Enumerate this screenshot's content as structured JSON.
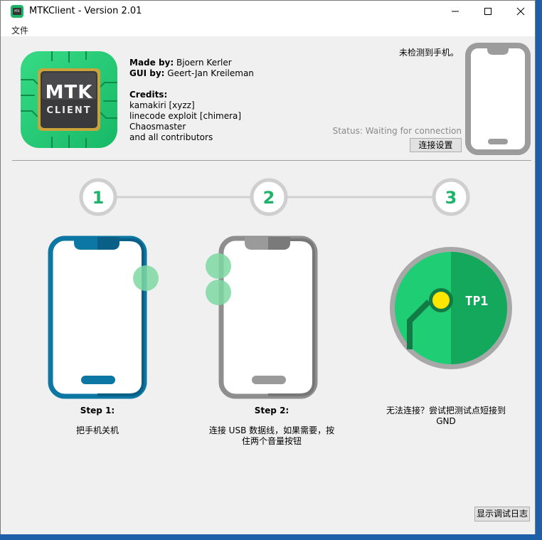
{
  "window": {
    "title": "MTKClient - Version 2.01",
    "icon_text": "MTK"
  },
  "menu": {
    "file": "文件"
  },
  "logo": {
    "line1": "MTK",
    "line2": "CLIENT"
  },
  "credits": {
    "made_by_label": "Made by:",
    "made_by": "Bjoern Kerler",
    "gui_by_label": "GUI by:",
    "gui_by": "Geert-Jan Kreileman",
    "credits_label": "Credits:",
    "names": [
      "kamakiri [xyzz]",
      "linecode exploit [chimera]",
      "Chaosmaster",
      "and all contributors"
    ]
  },
  "device": {
    "no_phone": "未检测到手机。",
    "status": "Status: Waiting for connection",
    "connect_button": "连接设置"
  },
  "steps": [
    {
      "number": "1",
      "title": "Step 1:",
      "desc_lines": [
        "把手机关机"
      ]
    },
    {
      "number": "2",
      "title": "Step 2:",
      "desc_lines": [
        "连接 USB 数据线，如果需要，按",
        "住两个音量按钮"
      ]
    },
    {
      "number": "3",
      "title": "",
      "desc_lines": [
        "无法连接？尝试把测试点短接到",
        "GND"
      ],
      "tp_label": "TP1"
    }
  ],
  "debug_button": "显示调试日志",
  "colors": {
    "accent_green": "#1fb36a",
    "step_phone_blue": "#0d77a3",
    "step_phone_gray": "#8e8e8e",
    "status_gray": "#8a8a8a"
  }
}
